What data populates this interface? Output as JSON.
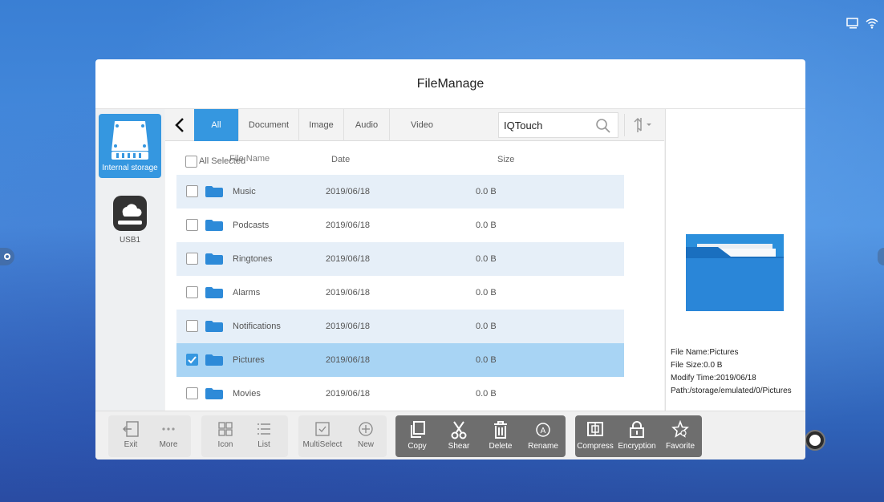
{
  "window": {
    "title": "FileManage"
  },
  "storage": [
    {
      "label": "Internal storage",
      "icon": "hard-drive-icon"
    },
    {
      "label": "USB1",
      "icon": "usb-drive-icon"
    }
  ],
  "tabs": [
    "All",
    "Document",
    "Image",
    "Audio",
    "Video"
  ],
  "search": {
    "value": "IQTouch"
  },
  "columns": {
    "select_all": "All Selected",
    "name": "File Name",
    "date": "Date",
    "size": "Size"
  },
  "files": [
    {
      "name": "Music",
      "date": "2019/06/18",
      "size": "0.0 B",
      "checked": false
    },
    {
      "name": "Podcasts",
      "date": "2019/06/18",
      "size": "0.0 B",
      "checked": false
    },
    {
      "name": "Ringtones",
      "date": "2019/06/18",
      "size": "0.0 B",
      "checked": false
    },
    {
      "name": "Alarms",
      "date": "2019/06/18",
      "size": "0.0 B",
      "checked": false
    },
    {
      "name": "Notifications",
      "date": "2019/06/18",
      "size": "0.0 B",
      "checked": false
    },
    {
      "name": "Pictures",
      "date": "2019/06/18",
      "size": "0.0 B",
      "checked": true
    },
    {
      "name": "Movies",
      "date": "2019/06/18",
      "size": "0.0 B",
      "checked": false
    }
  ],
  "detail": {
    "file_name": "File Name:Pictures",
    "file_size": "File Size:0.0 B",
    "modify_time": "Modify Time:2019/06/18",
    "path": "Path:/storage/emulated/0/Pictures"
  },
  "toolbar": {
    "exit": "Exit",
    "more": "More",
    "icon": "Icon",
    "list": "List",
    "multiselect": "MultiSelect",
    "new": "New",
    "copy": "Copy",
    "shear": "Shear",
    "delete": "Delete",
    "rename": "Rename",
    "compress": "Compress",
    "encryption": "Encryption",
    "favorite": "Favorite"
  },
  "colors": {
    "accent": "#3597e0",
    "selected_row": "#a8d4f4",
    "alt_row": "#e6eff8",
    "dark_group": "#6e6e6e"
  }
}
